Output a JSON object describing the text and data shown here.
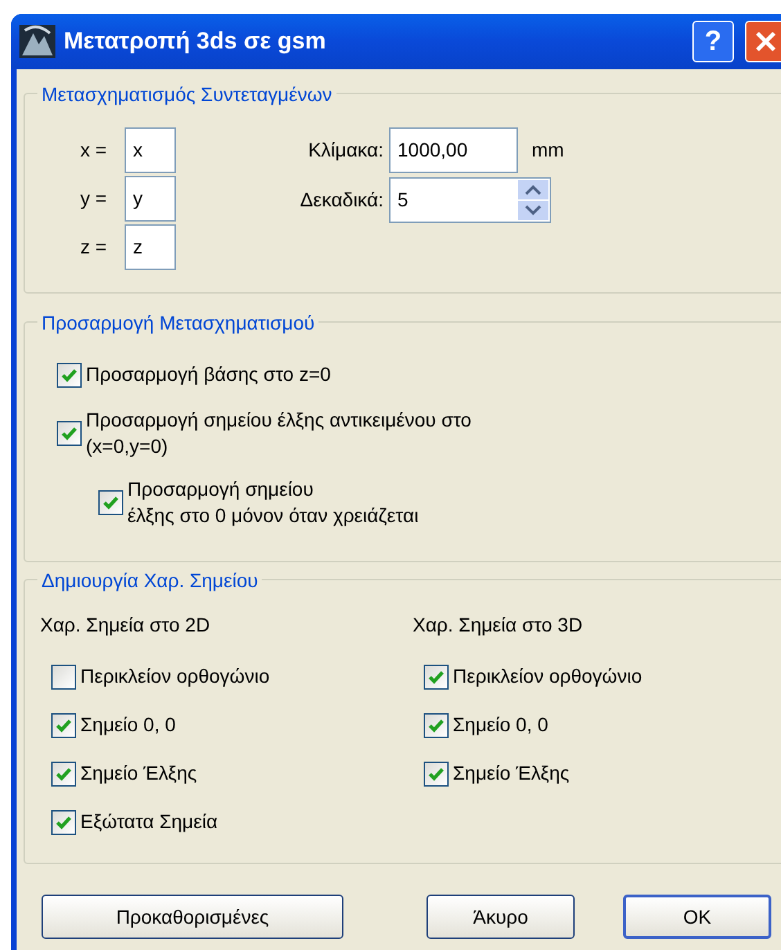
{
  "window": {
    "title": "Μετατροπή 3ds σε gsm",
    "help_button": "?"
  },
  "coordinates": {
    "legend": "Μετασχηματισμός Συντεταγμένων",
    "axes": [
      {
        "label": "x =",
        "value": "x"
      },
      {
        "label": "y =",
        "value": "y"
      },
      {
        "label": "z =",
        "value": "z"
      }
    ],
    "scale": {
      "label": "Κλίμακα:",
      "value": "1000,00",
      "unit": "mm"
    },
    "decimals": {
      "label": "Δεκαδικά:",
      "value": "5"
    }
  },
  "adjustment": {
    "legend": "Προσαρμογή Μετασχηματισμού",
    "options": [
      {
        "label": "Προσαρμογή βάσης στο z=0",
        "checked": true
      },
      {
        "label": "Προσαρμογή σημείου έλξης αντικειμένου στο\n(x=0,y=0)",
        "checked": true,
        "children": [
          {
            "label": "Προσαρμογή σημείου\nέλξης στο 0 μόνον όταν χρειάζεται",
            "checked": true
          }
        ]
      }
    ]
  },
  "hotspots": {
    "legend": "Δημιουργία Χαρ. Σημείου",
    "columns": [
      {
        "heading": "Χαρ. Σημεία στο 2D",
        "options": [
          {
            "label": "Περικλείον ορθογώνιο",
            "checked": false
          },
          {
            "label": "Σημείο 0, 0",
            "checked": true
          },
          {
            "label": "Σημείο Έλξης",
            "checked": true
          },
          {
            "label": "Εξώτατα Σημεία",
            "checked": true
          }
        ]
      },
      {
        "heading": "Χαρ. Σημεία στο 3D",
        "options": [
          {
            "label": "Περικλείον ορθογώνιο",
            "checked": true
          },
          {
            "label": "Σημείο 0, 0",
            "checked": true
          },
          {
            "label": "Σημείο Έλξης",
            "checked": true
          }
        ]
      }
    ]
  },
  "buttons": [
    {
      "label": "Προκαθορισμένες",
      "default": false
    },
    {
      "label": "Άκυρο",
      "default": false
    },
    {
      "label": "OK",
      "default": true
    }
  ]
}
